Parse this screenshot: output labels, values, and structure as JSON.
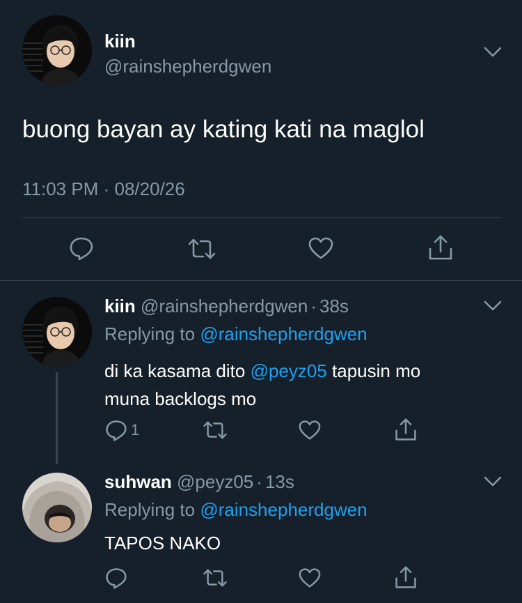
{
  "main_tweet": {
    "display_name": "kiin",
    "handle": "@rainshepherdgwen",
    "text": "buong bayan ay kating kati na maglol",
    "time": "11:03 PM",
    "separator": "·",
    "date": "08/20/26"
  },
  "replies": [
    {
      "display_name": "kiin",
      "handle": "@rainshepherdgwen",
      "dot": "·",
      "age": "38s",
      "replying_prefix": "Replying to ",
      "replying_to": "@rainshepherdgwen",
      "text_before": "di ka kasama dito ",
      "mention": "@peyz05",
      "text_after": " tapusin mo",
      "text_line2": "muna backlogs mo",
      "reply_count": "1"
    },
    {
      "display_name": "suhwan",
      "handle": "@peyz05",
      "dot": "·",
      "age": "13s",
      "replying_prefix": "Replying to ",
      "replying_to": "@rainshepherdgwen",
      "text": "TAPOS NAKO"
    }
  ],
  "colors": {
    "background": "#15202b",
    "muted": "#8899a6",
    "link": "#1da1f2",
    "divider": "#38444d"
  },
  "icons": [
    "chevron-down-icon",
    "reply-icon",
    "retweet-icon",
    "like-icon",
    "share-icon"
  ]
}
